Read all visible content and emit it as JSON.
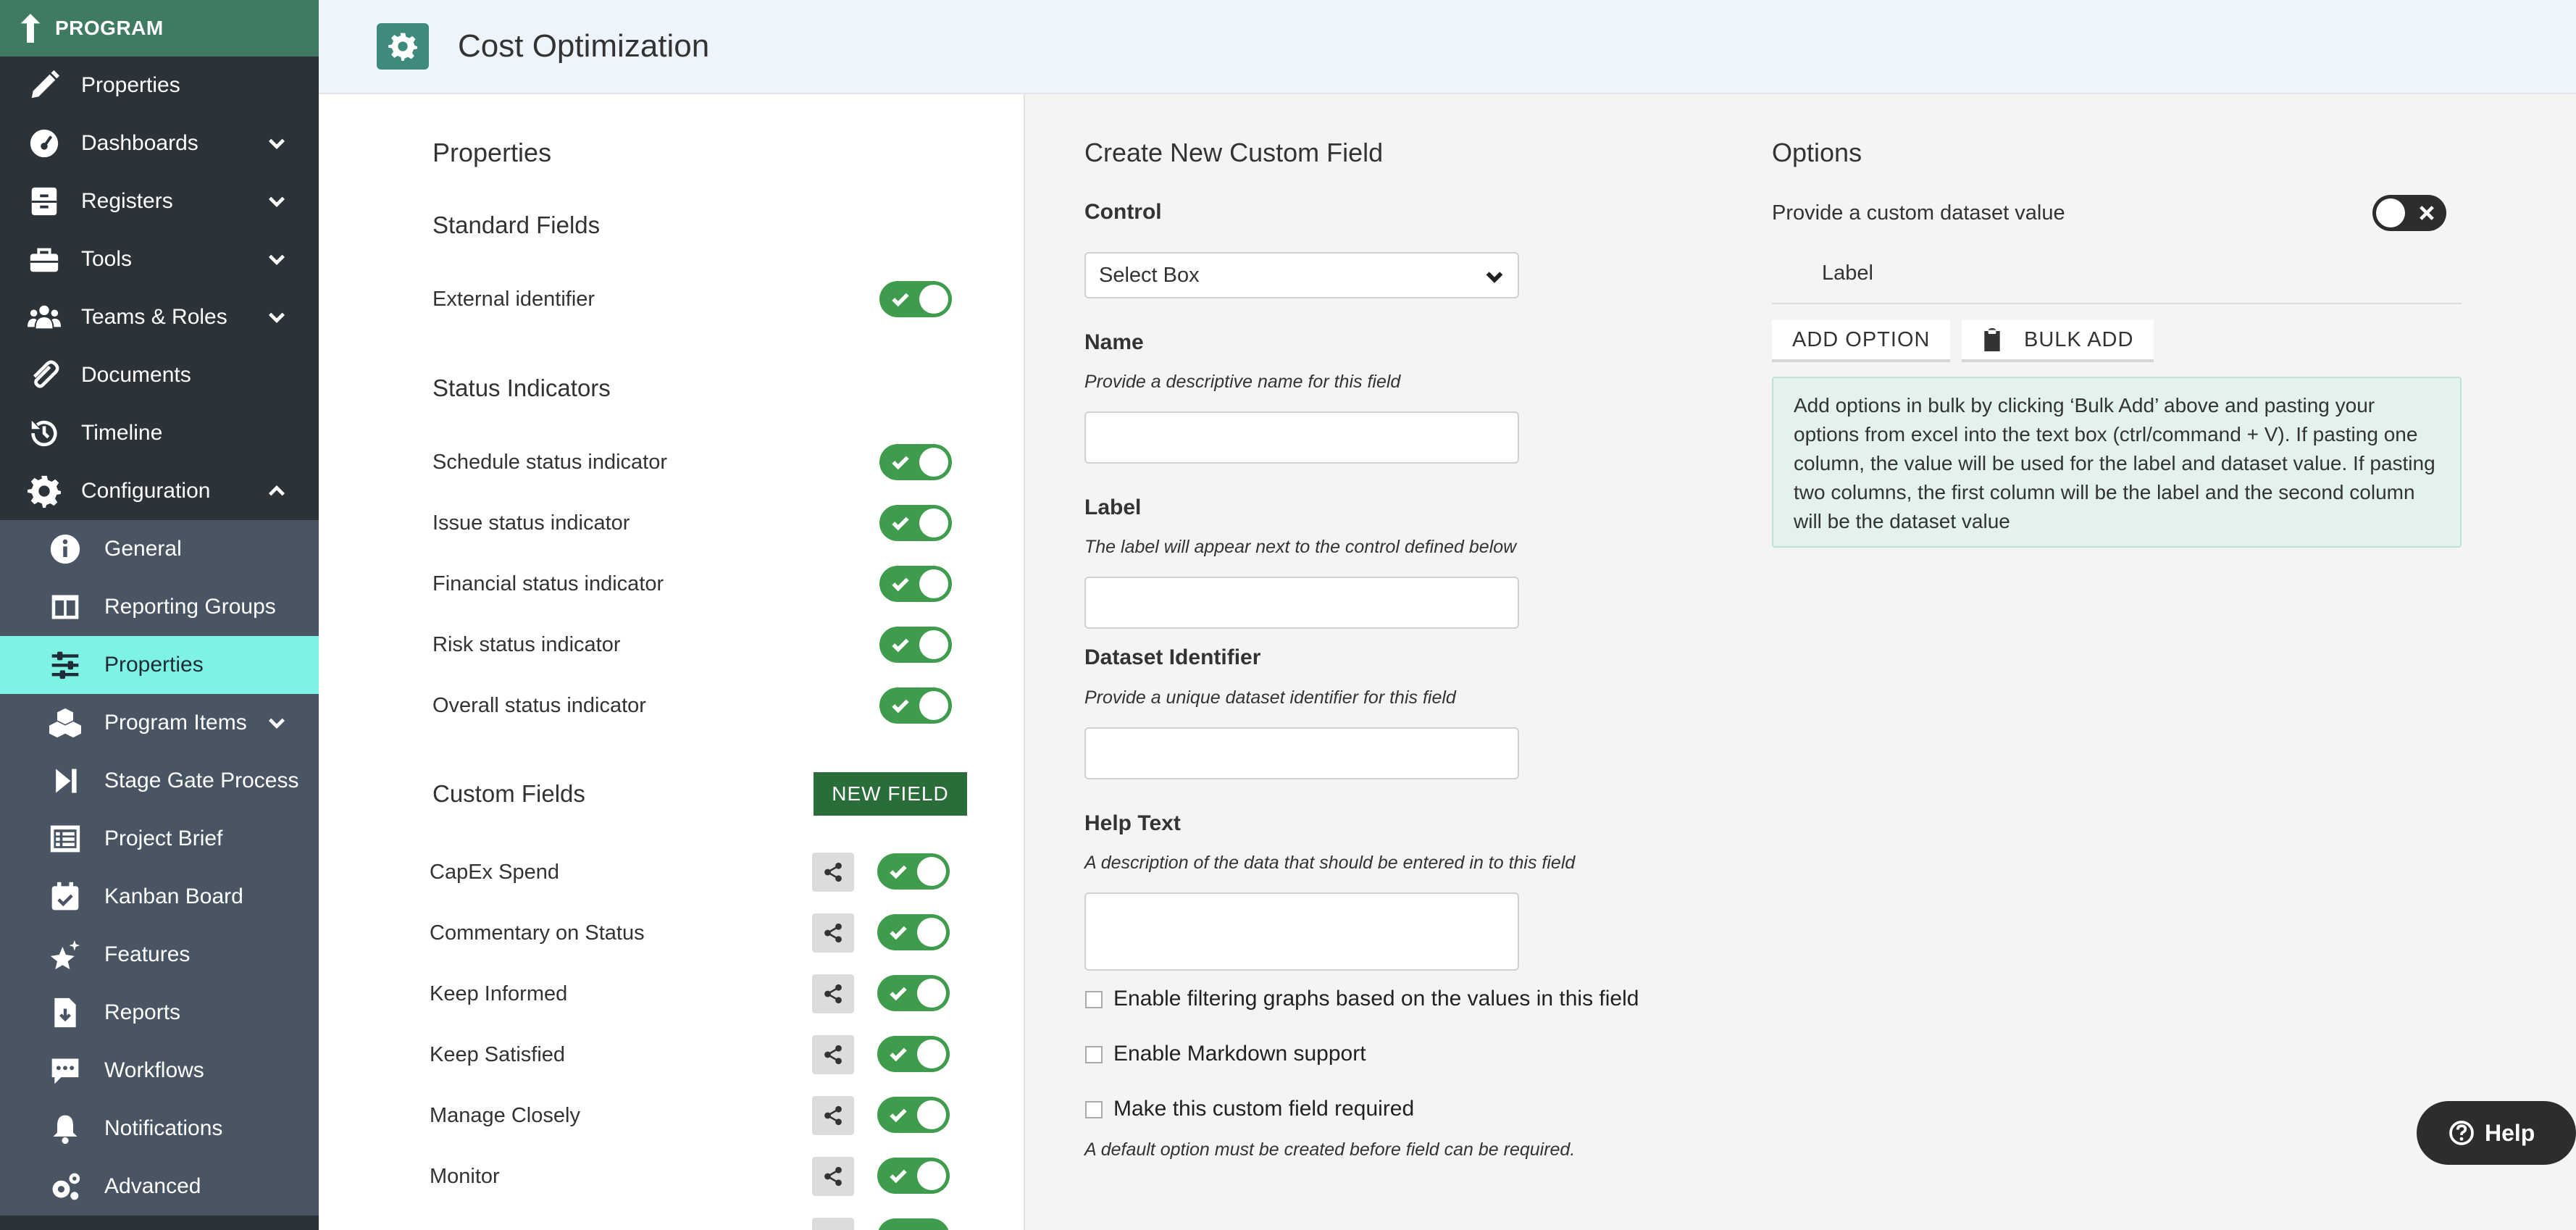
{
  "sidebar": {
    "brand": "PROGRAM",
    "items": [
      {
        "label": "Properties",
        "icon": "pencil-icon"
      },
      {
        "label": "Dashboards",
        "icon": "gauge-icon"
      },
      {
        "label": "Registers",
        "icon": "cabinet-icon"
      },
      {
        "label": "Tools",
        "icon": "toolbox-icon"
      },
      {
        "label": "Teams & Roles",
        "icon": "users-icon"
      },
      {
        "label": "Documents",
        "icon": "paperclip-icon"
      },
      {
        "label": "Timeline",
        "icon": "history-icon"
      },
      {
        "label": "Configuration",
        "icon": "gear-icon"
      }
    ],
    "config_items": [
      {
        "label": "General",
        "icon": "info-icon"
      },
      {
        "label": "Reporting Groups",
        "icon": "columns-icon"
      },
      {
        "label": "Properties",
        "icon": "sliders-icon"
      },
      {
        "label": "Program Items",
        "icon": "cubes-icon"
      },
      {
        "label": "Stage Gate Process",
        "icon": "step-forward-icon"
      },
      {
        "label": "Project Brief",
        "icon": "list-icon"
      },
      {
        "label": "Kanban Board",
        "icon": "calendar-check-icon"
      },
      {
        "label": "Features",
        "icon": "stars-icon"
      },
      {
        "label": "Reports",
        "icon": "file-download-icon"
      },
      {
        "label": "Workflows",
        "icon": "comment-dots-icon"
      },
      {
        "label": "Notifications",
        "icon": "bell-icon"
      },
      {
        "label": "Advanced",
        "icon": "cogs-icon"
      }
    ]
  },
  "header": {
    "title": "Cost Optimization"
  },
  "left": {
    "title": "Properties",
    "standard_heading": "Standard Fields",
    "standard_fields": [
      {
        "label": "External identifier",
        "enabled": true
      }
    ],
    "status_heading": "Status Indicators",
    "status_fields": [
      {
        "label": "Schedule status indicator",
        "enabled": true
      },
      {
        "label": "Issue status indicator",
        "enabled": true
      },
      {
        "label": "Financial status indicator",
        "enabled": true
      },
      {
        "label": "Risk status indicator",
        "enabled": true
      },
      {
        "label": "Overall status indicator",
        "enabled": true
      }
    ],
    "custom_heading": "Custom Fields",
    "new_field_label": "NEW FIELD",
    "custom_fields": [
      {
        "label": "CapEx Spend",
        "enabled": true
      },
      {
        "label": "Commentary on Status",
        "enabled": true
      },
      {
        "label": "Keep Informed",
        "enabled": true
      },
      {
        "label": "Keep Satisfied",
        "enabled": true
      },
      {
        "label": "Manage Closely",
        "enabled": true
      },
      {
        "label": "Monitor",
        "enabled": true
      }
    ]
  },
  "form": {
    "title": "Create New Custom Field",
    "control_label": "Control",
    "control_value": "Select Box",
    "name_label": "Name",
    "name_hint": "Provide a descriptive name for this field",
    "name_value": "",
    "label_label": "Label",
    "label_hint": "The label will appear next to the control defined below",
    "label_value": "",
    "dataset_label": "Dataset Identifier",
    "dataset_hint": "Provide a unique dataset identifier for this field",
    "dataset_value": "",
    "help_label": "Help Text",
    "help_hint": "A description of the data that should be entered in to this field",
    "help_value": "",
    "cb_filter": "Enable filtering graphs based on the values in this field",
    "cb_markdown": "Enable Markdown support",
    "cb_required": "Make this custom field required",
    "required_note": "A default option must be created before field can be required."
  },
  "options": {
    "title": "Options",
    "custom_dataset_label": "Provide a custom dataset value",
    "custom_dataset_enabled": false,
    "label_header": "Label",
    "add_option": "ADD OPTION",
    "bulk_add": "BULK ADD",
    "info": "Add options in bulk by clicking ‘Bulk Add’ above and pasting your options from excel into the text box (ctrl/command + V). If pasting one column, the value will be used for the label and dataset value. If pasting two columns, the first column will be the label and the second column will be the dataset value"
  },
  "help_button": "Help",
  "colors": {
    "sidebar": "#2b3238",
    "brand": "#3f7a63",
    "active": "#7ff2e6",
    "toggle_on": "#3e9c4c",
    "new_field": "#2a6d3b"
  }
}
